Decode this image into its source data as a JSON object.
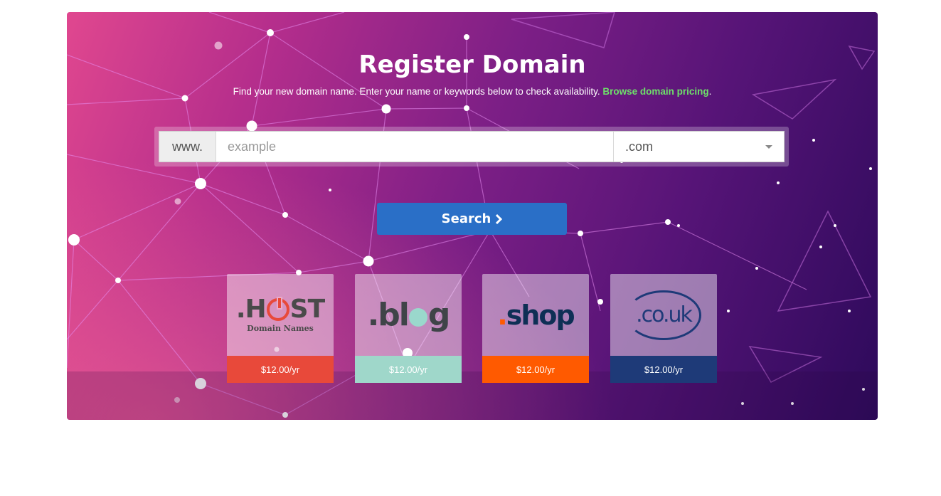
{
  "hero": {
    "title": "Register Domain",
    "subtitle_text": "Find your new domain name. Enter your name or keywords below to check availability.",
    "pricing_link": "Browse domain pricing",
    "subtitle_end": "."
  },
  "search": {
    "prefix": "www.",
    "placeholder": "example",
    "tld_selected": ".com",
    "button_label": "Search"
  },
  "featured_tlds": [
    {
      "logo_text_1": ".H",
      "logo_text_2": "ST",
      "logo_subtext": "Domain Names",
      "price": "$12.00/yr",
      "color": "#e8493a"
    },
    {
      "logo_text_1": ".bl",
      "logo_text_2": "g",
      "price": "$12.00/yr",
      "color": "#9fd7ca"
    },
    {
      "logo_dot": ".",
      "logo_text": "shop",
      "price": "$12.00/yr",
      "color": "#ff5a00"
    },
    {
      "logo_text": ".co.uk",
      "price": "$12.00/yr",
      "color": "#1e3a78"
    }
  ],
  "colors": {
    "link_green": "#6ee06a",
    "button_blue": "#2a6fc7"
  }
}
